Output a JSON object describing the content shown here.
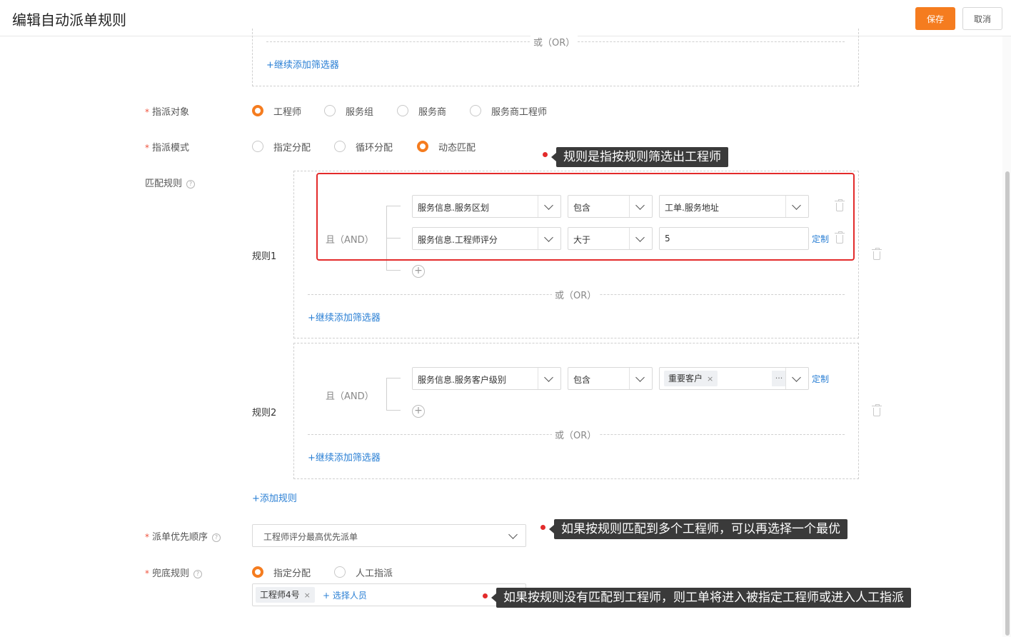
{
  "header": {
    "title": "编辑自动派单规则",
    "save_label": "保存",
    "cancel_label": "取消"
  },
  "top_filter": {
    "or_label": "或（OR）",
    "add_label": "+继续添加筛选器"
  },
  "assign_target": {
    "label": "指派对象",
    "options": [
      "工程师",
      "服务组",
      "服务商",
      "服务商工程师"
    ],
    "selected_index": 0
  },
  "assign_mode": {
    "label": "指派模式",
    "options": [
      "指定分配",
      "循环分配",
      "动态匹配"
    ],
    "selected_index": 2
  },
  "match_rules": {
    "label": "匹配规则",
    "help_icon": "question-icon",
    "rules": [
      {
        "name": "规则1",
        "and_label": "且（AND）",
        "conditions": [
          {
            "field": "服务信息.服务区划",
            "operator": "包含",
            "value": "工单.服务地址",
            "custom_link": ""
          },
          {
            "field": "服务信息.工程师评分",
            "operator": "大于",
            "value": "5",
            "custom_link": "定制"
          }
        ],
        "or_label": "或（OR）",
        "add_label": "+继续添加筛选器"
      },
      {
        "name": "规则2",
        "and_label": "且（AND）",
        "conditions": [
          {
            "field": "服务信息.服务客户级别",
            "operator": "包含",
            "tags": [
              "重要客户"
            ],
            "more": "···",
            "custom_link": "定制"
          }
        ],
        "or_label": "或（OR）",
        "add_label": "+继续添加筛选器"
      }
    ],
    "add_rule_label": "+添加规则"
  },
  "priority": {
    "label": "派单优先顺序",
    "value": "工程师评分最高优先派单"
  },
  "fallback": {
    "label": "兜底规则",
    "options": [
      "指定分配",
      "人工指派"
    ],
    "selected_index": 0,
    "tags": [
      "工程师4号"
    ],
    "select_label": "+ 选择人员"
  },
  "callouts": [
    "规则是指按规则筛选出工程师",
    "如果按规则匹配到多个工程师，可以再选择一个最优",
    "如果按规则没有匹配到工程师，则工单将进入被指定工程师或进入人工指派"
  ],
  "colors": {
    "accent": "#f57c1f",
    "link": "#2a7fd4",
    "highlight": "#e32b2b",
    "callout_bg": "#3a3a3a"
  }
}
